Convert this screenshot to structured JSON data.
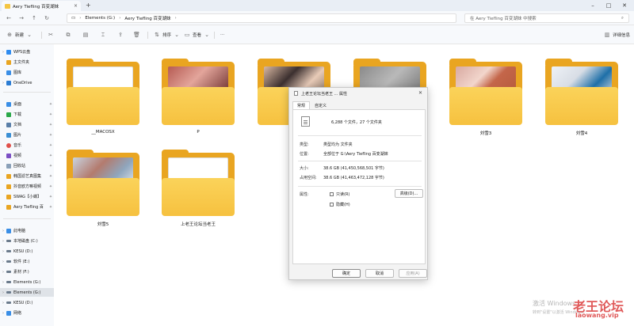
{
  "window": {
    "tab_title": "Aery Tiefling 百变湖妹",
    "tab_close": "×",
    "new_tab": "+",
    "controls": {
      "minimize": "–",
      "maximize": "□",
      "close": "✕"
    }
  },
  "address": {
    "path": [
      "Elements (G:)",
      "Aery Tiefling 百变湖妹"
    ],
    "separator": "›",
    "search_placeholder": "在 Aery Tiefling 百变湖妹 中搜索"
  },
  "toolbar": {
    "new_label": "新建",
    "sort_label": "排序",
    "view_label": "查看",
    "more_label": "···",
    "details_label": "详细信息"
  },
  "sidebar": {
    "items": [
      {
        "label": "WPS云盘",
        "color": "#2f8cf0",
        "chev": "›"
      },
      {
        "label": "主文件夹",
        "color": "#e9a521",
        "chev": ""
      },
      {
        "label": "图库",
        "color": "#3a8ee6",
        "chev": ""
      },
      {
        "label": "OneDrive",
        "color": "#2b7cd3",
        "chev": "›"
      },
      {
        "label": "桌面",
        "color": "#3a8ee6",
        "pin": "📌"
      },
      {
        "label": "下载",
        "color": "#2ba84a",
        "pin": "📌"
      },
      {
        "label": "文档",
        "color": "#5a7fa8",
        "pin": "📌"
      },
      {
        "label": "图片",
        "color": "#3b8fd4",
        "pin": "📌"
      },
      {
        "label": "音乐",
        "color": "#e0504a",
        "pin": "📌"
      },
      {
        "label": "视频",
        "color": "#7b4fc4",
        "pin": "📌"
      },
      {
        "label": "回收站",
        "color": "#8aa0b8",
        "pin": "📌"
      },
      {
        "label": "韩国滤艺真图集",
        "color": "#e9a521",
        "pin": "📌"
      },
      {
        "label": "抖音欧方嘛视频",
        "color": "#e9a521",
        "pin": "📌"
      },
      {
        "label": "SWAG【小蝶】",
        "color": "#e9a521",
        "pin": "📌"
      },
      {
        "label": "Aery Tiefling 百",
        "color": "#e9a521",
        "pin": "📌"
      },
      {
        "label": "此电脑",
        "color": "#3a8ee6",
        "chev": "›"
      },
      {
        "label": "本地磁盘 (C:)",
        "color": "#6b7b8c",
        "chev": "›"
      },
      {
        "label": "KESU (D:)",
        "color": "#6b7b8c",
        "chev": "›"
      },
      {
        "label": "软件 (E:)",
        "color": "#6b7b8c",
        "chev": "›"
      },
      {
        "label": "素材 (F:)",
        "color": "#6b7b8c",
        "chev": "›"
      },
      {
        "label": "Elements (G:)",
        "color": "#6b7b8c",
        "chev": "›"
      },
      {
        "label": "Elements (G:)",
        "color": "#6b7b8c",
        "chev": "›",
        "active": true
      },
      {
        "label": "KESU (D:)",
        "color": "#6b7b8c",
        "chev": "›"
      },
      {
        "label": "网络",
        "color": "#3a8ee6",
        "chev": "›"
      }
    ]
  },
  "folders": [
    {
      "name": "__MACOSX",
      "thumb": "doc"
    },
    {
      "name": "P",
      "thumb": "ph1"
    },
    {
      "name": "",
      "thumb": "ph2"
    },
    {
      "name": "",
      "thumb": "ph3"
    },
    {
      "name": "刘雪3",
      "thumb": "ph4"
    },
    {
      "name": "刘雪4",
      "thumb": "ph5"
    },
    {
      "name": "刘雪5",
      "thumb": "ph6"
    },
    {
      "name": "上老王论坛当老王",
      "thumb": "doc"
    }
  ],
  "dialog": {
    "title": "上老王论坛当老王 ... 属性",
    "close": "✕",
    "tabs": [
      "常规",
      "自定义"
    ],
    "summary": "6,288 个文件，27 个文件夹",
    "rows": [
      {
        "k": "类型:",
        "v": "类型均为 文件夹"
      },
      {
        "k": "位置:",
        "v": "全部位于 G:\\Aery Tiefling 百变湖妹"
      },
      {
        "k": "大小:",
        "v": "38.6 GB (41,450,568,501 字节)"
      },
      {
        "k": "占用空间:",
        "v": "38.6 GB (41,463,472,128 字节)"
      }
    ],
    "attr_label": "属性:",
    "readonly_label": "只读(R)",
    "hidden_label": "隐藏(H)",
    "advanced_label": "高级(D)...",
    "ok_label": "确定",
    "cancel_label": "取消",
    "apply_label": "应用(A)"
  },
  "watermark": {
    "activate_title": "激活 Windows",
    "activate_sub": "转到\"设置\"以激活 Windows。",
    "logo": "老王论坛",
    "url": "laowang.vip"
  }
}
